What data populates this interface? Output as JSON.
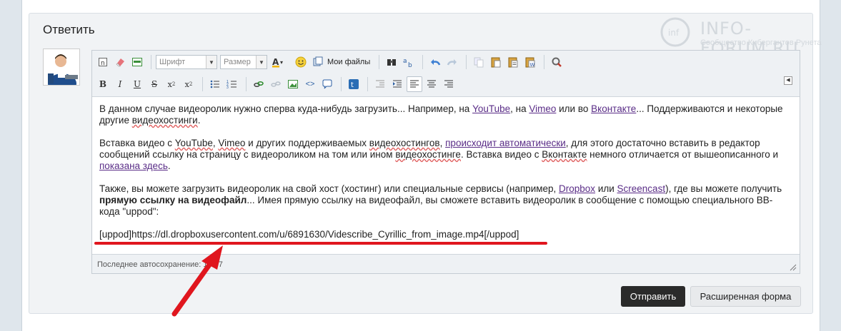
{
  "reply_title": "Ответить",
  "logo": {
    "name": "INFO-FORUM.RU",
    "sub": "Сообщество Кибергантов Рунета"
  },
  "toolbar": {
    "font_select": "Шрифт",
    "size_select": "Размер",
    "my_files": "Мои файлы"
  },
  "content": {
    "p1_pre": "В данном случае видеоролик нужно сперва куда-нибудь загрузить... Например, на ",
    "youtube": "YouTube",
    "p1_mid1": ", на ",
    "vimeo": "Vimeo",
    "p1_mid2": " или во ",
    "vk": "Вконтакте",
    "p1_post": "... Поддерживаются и некоторые другие ",
    "p1_word": "видеохостинги",
    "p1_end": ".",
    "p2_pre": "Вставка видео с ",
    "p2_youtube": "YouTube",
    "p2_comma": ", ",
    "p2_vimeo": "Vimeo",
    "p2_mid": " и других поддерживаемых ",
    "p2_word1": "видеохостингов",
    "p2_comma2": ", ",
    "p2_link": "происходит автоматически",
    "p2_mid2": ", для этого достаточно вставить в редактор сообщений ссылку на страницу с видеороликом на том или ином ",
    "p2_word2": "видеохостинге",
    "p2_mid3": ". Вставка видео с ",
    "p2_vk": "Вконтакте",
    "p2_mid4": " немного отличается от вышеописанного и ",
    "p2_link2": "показана здесь",
    "p2_end": ".",
    "p3_pre": "Также, вы можете загрузить видеоролик на свой хост (хостинг) или специальные сервисы (например, ",
    "dropbox": "Dropbox",
    "p3_or": " или ",
    "screencast": "Screencast",
    "p3_mid": "), где вы можете получить ",
    "p3_bold": "прямую ссылку на видеофайл",
    "p3_end": "... Имея прямую ссылку на видеофайл, вы сможете вставить видеоролик в сообщение с помощью специального BB-кода \"uppod\":",
    "bbcode": "[uppod]https://dl.dropboxusercontent.com/u/6891630/Videscribe_Cyrillic_from_image.mp4[/uppod]"
  },
  "autosave": "Последнее автосохранение: 19:47",
  "buttons": {
    "send": "Отправить",
    "advanced": "Расширенная форма"
  },
  "colors": {
    "annotation_red": "#e0161e",
    "send_bg": "#2a2a2a",
    "link": "#5a2d87"
  }
}
